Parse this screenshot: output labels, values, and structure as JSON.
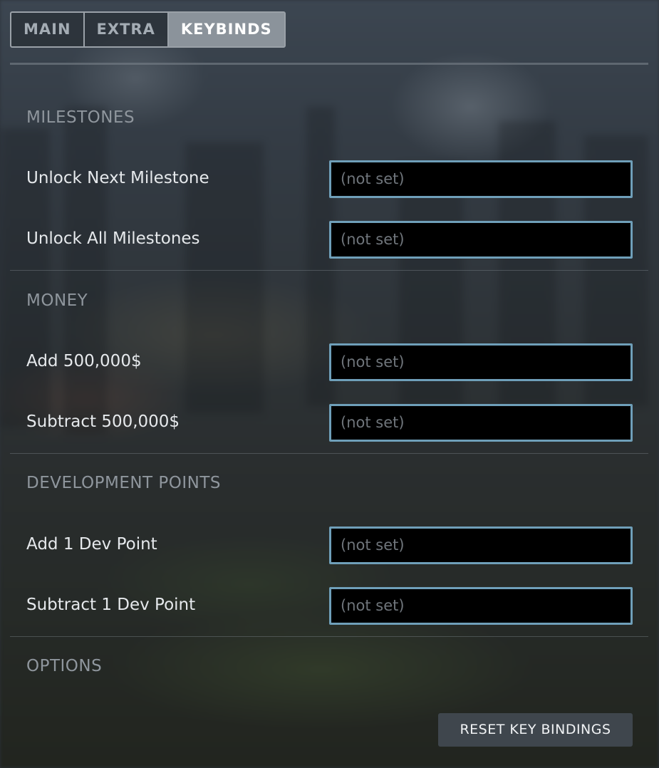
{
  "tabs": [
    {
      "label": "MAIN",
      "active": false
    },
    {
      "label": "EXTRA",
      "active": false
    },
    {
      "label": "KEYBINDS",
      "active": true
    }
  ],
  "sections": {
    "milestones": {
      "title": "MILESTONES",
      "rows": [
        {
          "label": "Unlock Next Milestone",
          "value": "(not set)"
        },
        {
          "label": "Unlock All Milestones",
          "value": "(not set)"
        }
      ]
    },
    "money": {
      "title": "MONEY",
      "rows": [
        {
          "label": "Add 500,000$",
          "value": "(not set)"
        },
        {
          "label": "Subtract 500,000$",
          "value": "(not set)"
        }
      ]
    },
    "development_points": {
      "title": "DEVELOPMENT POINTS",
      "rows": [
        {
          "label": "Add 1 Dev Point",
          "value": "(not set)"
        },
        {
          "label": "Subtract 1 Dev Point",
          "value": "(not set)"
        }
      ]
    },
    "options": {
      "title": "OPTIONS",
      "reset_button_label": "RESET KEY BINDINGS"
    }
  },
  "colors": {
    "keybox_border": "#6f9fb9",
    "active_tab_bg": "#8b939b",
    "section_title": "#8f969d"
  }
}
